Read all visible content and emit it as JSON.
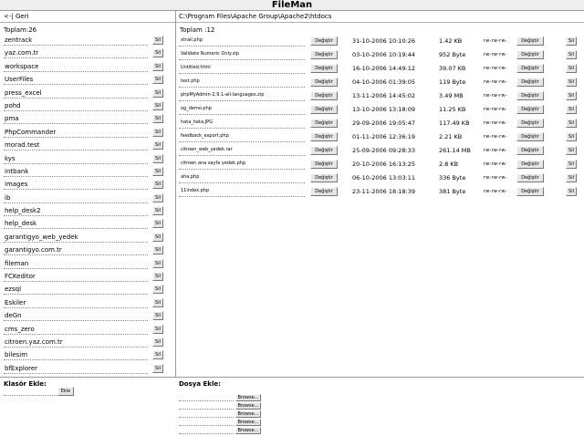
{
  "app": {
    "title": "FileMan"
  },
  "nav": {
    "back_label": "<-| Geri",
    "path": "C:\\Program Files\\Apache Group\\Apache2\\htdocs"
  },
  "folders": {
    "total_label": "Toplam:26",
    "items": [
      {
        "name": "zentrack"
      },
      {
        "name": "yaz.com.tr"
      },
      {
        "name": "workspace"
      },
      {
        "name": "UserFiles"
      },
      {
        "name": "press_excel"
      },
      {
        "name": "pohd"
      },
      {
        "name": "pma"
      },
      {
        "name": "PhpCommander"
      },
      {
        "name": "morad.test"
      },
      {
        "name": "kys"
      },
      {
        "name": "intbank"
      },
      {
        "name": "images"
      },
      {
        "name": "ib"
      },
      {
        "name": "help_desk2"
      },
      {
        "name": "help_desk"
      },
      {
        "name": "garantigyo_web_yedek"
      },
      {
        "name": "garantigyo.com.tr"
      },
      {
        "name": "fileman"
      },
      {
        "name": "FCKeditor"
      },
      {
        "name": "ezsql"
      },
      {
        "name": "Eskiler"
      },
      {
        "name": "deGn"
      },
      {
        "name": "cms_zero"
      },
      {
        "name": "citroen.yaz.com.tr"
      },
      {
        "name": "bilesim"
      },
      {
        "name": "bfExplorer"
      }
    ],
    "delete_label": "Sil"
  },
  "files": {
    "total_label": "Toplam :12",
    "rename_label": "Değiştir",
    "delete_label": "Sil",
    "items": [
      {
        "name": "xtrail.php",
        "date": "31-10-2006 10:10:26",
        "size": "1.42 KB",
        "perm": "rw-rw-rw-"
      },
      {
        "name": "Validate Numeric Only.zip",
        "date": "03-10-2006 10:19:44",
        "size": "952 Byte",
        "perm": "rw-rw-rw-"
      },
      {
        "name": "Untitled.html",
        "date": "16-10-2006 14:49:12",
        "size": "39.07 KB",
        "perm": "rw-rw-rw-"
      },
      {
        "name": "test.php",
        "date": "04-10-2006 01:39:05",
        "size": "119 Byte",
        "perm": "rw-rw-rw-"
      },
      {
        "name": "phpMyAdmin-2.9.1-all-languages.zip",
        "date": "13-11-2006 14:45:02",
        "size": "3.49 MB",
        "perm": "rw-rw-rw-"
      },
      {
        "name": "og_demo.php",
        "date": "13-10-2006 13:18:09",
        "size": "11.25 KB",
        "perm": "rw-rw-rw-"
      },
      {
        "name": "hata_hata.JPG",
        "date": "29-09-2006 19:05:47",
        "size": "117.49 KB",
        "perm": "rw-rw-rw-"
      },
      {
        "name": "feedback_export.php",
        "date": "01-11-2006 12:36:19",
        "size": "2.21 KB",
        "perm": "rw-rw-rw-"
      },
      {
        "name": "citroen_web_yedek.rar",
        "date": "25-09-2006 09:28:33",
        "size": "261.14 MB",
        "perm": "rw-rw-rw-"
      },
      {
        "name": "citroen ana sayfa yedek.php",
        "date": "20-10-2006 16:13:25",
        "size": "2.8 KB",
        "perm": "rw-rw-rw-"
      },
      {
        "name": "aha.php",
        "date": "06-10-2006 13:03:11",
        "size": "336 Byte",
        "perm": "rw-rw-rw-"
      },
      {
        "name": "11index.php",
        "date": "23-11-2006 18:18:39",
        "size": "381 Byte",
        "perm": "rw-rw-rw-"
      }
    ]
  },
  "forms": {
    "folder_label": "Klasör Ekle:",
    "add_label": "Ekle",
    "file_label": "Dosya Ekle:",
    "browse_label": "Browse...",
    "upload_slots": 5
  }
}
